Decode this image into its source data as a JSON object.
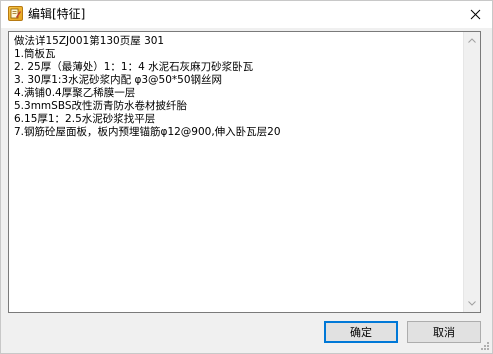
{
  "window": {
    "title": "编辑[特征]"
  },
  "editor": {
    "lines": [
      "做法详15ZJ001第130页屋 301",
      "1.筒板瓦",
      "2. 25厚（最薄处）1：1：4 水泥石灰麻刀砂浆卧瓦",
      "3. 30厚1:3水泥砂浆内配 φ3@50*50钢丝网",
      "4.满铺0.4厚聚乙稀膜一层",
      "5.3mmSBS改性沥青防水卷材披纤胎",
      "6.15厚1：2.5水泥砂浆找平层",
      "7.钢筋砼屋面板，板内预埋锚筋φ12@900,伸入卧瓦层20"
    ]
  },
  "buttons": {
    "ok_label": "确定",
    "cancel_label": "取消"
  },
  "colors": {
    "accent": "#0078d7",
    "window_bg": "#f0f0f0",
    "titlebar_bg": "#ffffff",
    "icon_color": "#e6a21e"
  },
  "icons": {
    "app": "edit-note-icon",
    "close": "close-icon",
    "scroll_up": "chevron-up-icon",
    "scroll_down": "chevron-down-icon",
    "resize": "resize-grip-icon"
  }
}
